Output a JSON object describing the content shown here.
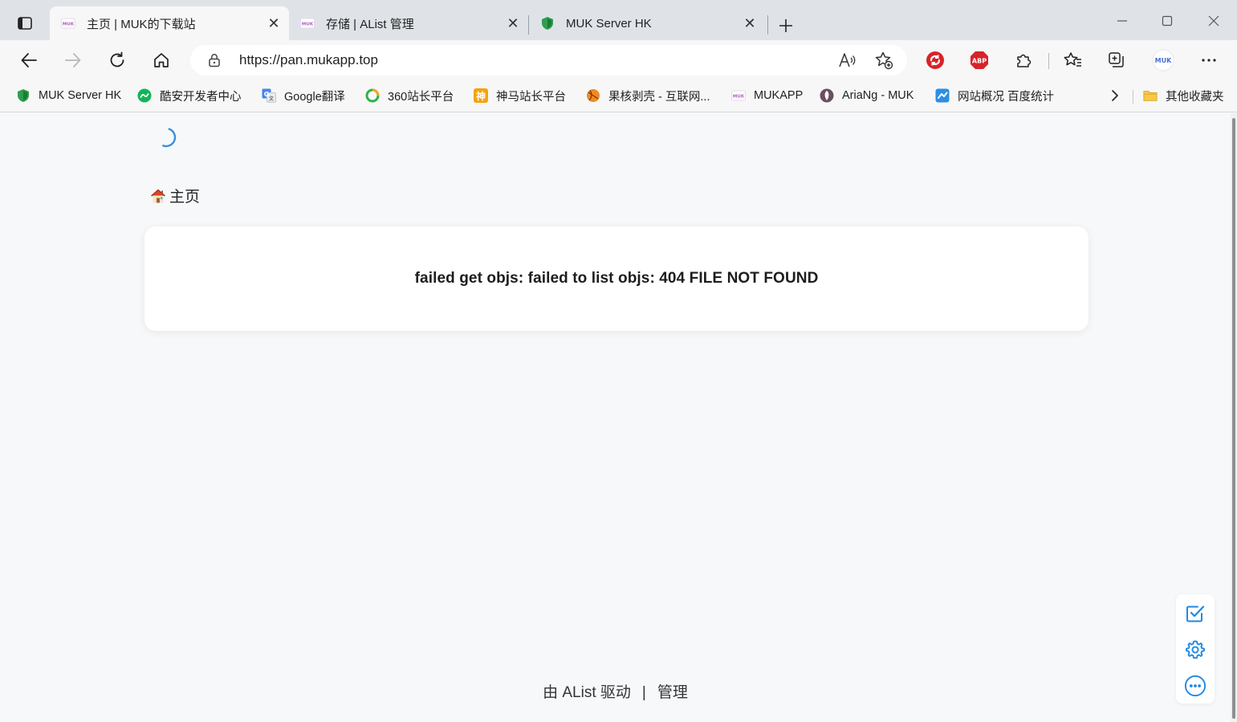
{
  "tabs": [
    {
      "title": "主页 | MUK的下载站",
      "favicon": "muk-icon",
      "active": true
    },
    {
      "title": "存储 | AList 管理",
      "favicon": "muk-icon",
      "active": false
    },
    {
      "title": "MUK Server HK",
      "favicon": "green-shield-icon",
      "active": false
    }
  ],
  "address_bar": {
    "url": "https://pan.mukapp.top"
  },
  "bookmarks": [
    {
      "label": "MUK Server HK",
      "icon": "green-shield-icon"
    },
    {
      "label": "酷安开发者中心",
      "icon": "coolapk-icon"
    },
    {
      "label": "Google翻译",
      "icon": "google-translate-icon"
    },
    {
      "label": "360站长平台",
      "icon": "360-icon"
    },
    {
      "label": "神马站长平台",
      "icon": "shenma-icon"
    },
    {
      "label": "果核剥壳 - 互联网...",
      "icon": "orange-ball-icon"
    },
    {
      "label": "MUKAPP",
      "icon": "muk-icon"
    },
    {
      "label": "AriaNg - MUK",
      "icon": "ariang-icon"
    },
    {
      "label": "网站概况 百度统计",
      "icon": "baidu-tongji-icon"
    }
  ],
  "other_favorites": "其他收藏夹",
  "extensions": {
    "muk_badge": "MUK",
    "abp_badge": "ABP",
    "shenma_glyph": "神",
    "muk_fav_text": "MUK"
  },
  "page": {
    "breadcrumb_home": "主页",
    "error_message": "failed get objs: failed to list objs: 404 FILE NOT FOUND",
    "footer_powered": "由 AList 驱动",
    "footer_separator": "|",
    "footer_manage": "管理"
  },
  "colors": {
    "accent_blue": "#1e88e5",
    "edge_tab_bg": "#dfe3e8",
    "page_bg": "#f7f8fa"
  }
}
